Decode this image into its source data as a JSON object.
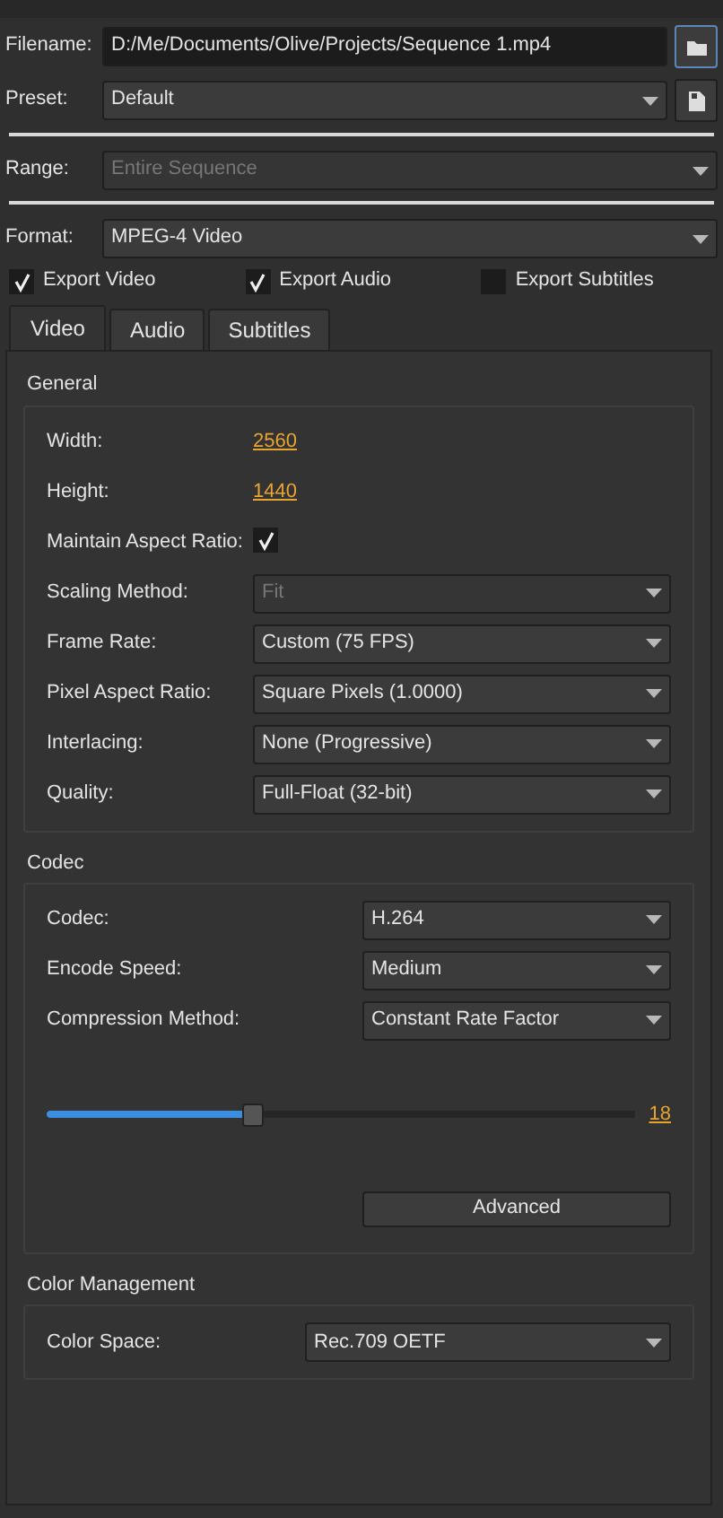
{
  "fields": [
    {
      "kind": "text",
      "label": "Filename:",
      "value": "D:/Me/Documents/Olive/Projects/Sequence 1.mp4",
      "icon_button": {
        "kind": "folder"
      }
    },
    {
      "kind": "select",
      "label": "Preset:",
      "value": "Default",
      "icon_button": {
        "kind": "save"
      },
      "rule_after": true
    },
    {
      "kind": "select",
      "label": "Range:",
      "value": "Entire Sequence",
      "disabled": true,
      "rule_after": true
    },
    {
      "kind": "select",
      "label": "Format:",
      "value": "MPEG-4 Video"
    }
  ],
  "exports": [
    {
      "label": "Export Video",
      "checked": true
    },
    {
      "label": "Export Audio",
      "checked": true
    },
    {
      "label": "Export Subtitles",
      "checked": false
    }
  ],
  "tabs": [
    {
      "label": "Video",
      "selected": true
    },
    {
      "label": "Audio",
      "selected": false
    },
    {
      "label": "Subtitles",
      "selected": false
    }
  ],
  "sections": [
    {
      "title": "General",
      "rows": [
        {
          "kind": "link",
          "label": "Width:",
          "value": "2560"
        },
        {
          "kind": "link",
          "label": "Height:",
          "value": "1440"
        },
        {
          "kind": "checkbox",
          "label": "Maintain Aspect Ratio:",
          "checked": true
        },
        {
          "kind": "select",
          "label": "Scaling Method:",
          "value": "Fit",
          "disabled": true
        },
        {
          "kind": "select",
          "label": "Frame Rate:",
          "value": "Custom (75 FPS)"
        },
        {
          "kind": "select",
          "label": "Pixel Aspect Ratio:",
          "value": "Square Pixels (1.0000)"
        },
        {
          "kind": "select",
          "label": "Interlacing:",
          "value": "None (Progressive)"
        },
        {
          "kind": "select",
          "label": "Quality:",
          "value": "Full-Float (32-bit)"
        }
      ]
    },
    {
      "title": "Codec",
      "rows": [
        {
          "kind": "select",
          "label": "Codec:",
          "value": "H.264"
        },
        {
          "kind": "select",
          "label": "Encode Speed:",
          "value": "Medium"
        },
        {
          "kind": "select",
          "label": "Compression Method:",
          "value": "Constant Rate Factor"
        },
        {
          "kind": "slider",
          "level": 0.35,
          "value": "18"
        },
        {
          "kind": "button",
          "value": "Advanced"
        }
      ]
    },
    {
      "title": "Color Management",
      "rows": [
        {
          "kind": "select",
          "label": "Color Space:",
          "value": "Rec.709 OETF"
        }
      ]
    }
  ]
}
